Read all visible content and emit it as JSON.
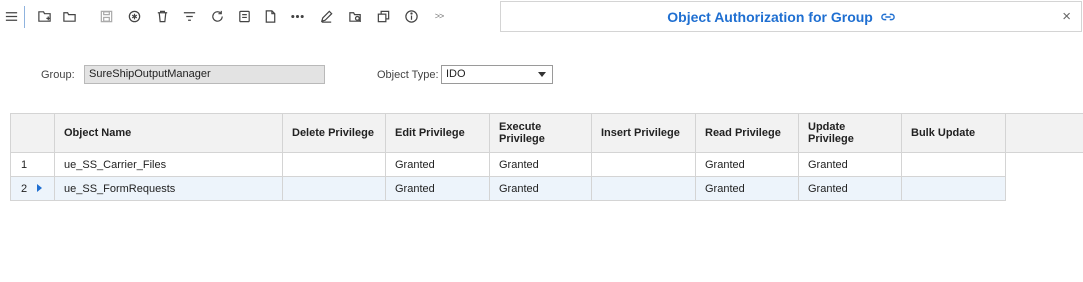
{
  "toolbar": {
    "icons": [
      "menu-icon",
      "new-record-icon",
      "open-folder-icon",
      "save-icon",
      "asterisk-icon",
      "delete-icon",
      "filter-icon",
      "refresh-icon",
      "document-icon",
      "blank-page-icon",
      "more-icon",
      "edit-icon",
      "find-icon",
      "copy-icon",
      "info-icon"
    ],
    "more_label": ">>"
  },
  "header": {
    "title": "Object Authorization for Group",
    "close_label": "×"
  },
  "form": {
    "group_label": "Group:",
    "group_value": "SureShipOutputManager",
    "object_type_label": "Object Type:",
    "object_type_value": "IDO"
  },
  "grid": {
    "columns": [
      "Object Name",
      "Delete Privilege",
      "Edit Privilege",
      "Execute Privilege",
      "Insert Privilege",
      "Read Privilege",
      "Update Privilege",
      "Bulk Update"
    ],
    "rows": [
      {
        "num": "1",
        "object_name": "ue_SS_Carrier_Files",
        "delete": "",
        "edit": "Granted",
        "execute": "Granted",
        "insert": "",
        "read": "Granted",
        "update": "Granted",
        "bulk": ""
      },
      {
        "num": "2",
        "object_name": "ue_SS_FormRequests",
        "delete": "",
        "edit": "Granted",
        "execute": "Granted",
        "insert": "",
        "read": "Granted",
        "update": "Granted",
        "bulk": ""
      }
    ]
  },
  "colors": {
    "accent": "#1f6fd1",
    "selected_row": "#edf4fb",
    "header_bg": "#f2f2f2"
  }
}
